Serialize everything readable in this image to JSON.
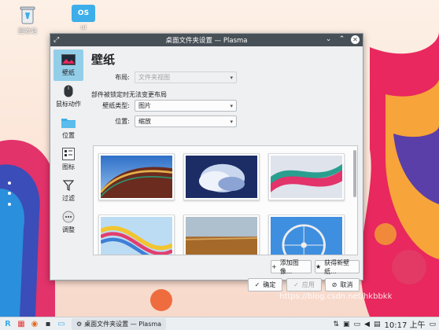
{
  "desktop": {
    "icons": [
      {
        "label": "回收站"
      },
      {
        "label": "OS",
        "caption": "ui"
      }
    ]
  },
  "dialog": {
    "title": "桌面文件夹设置 — Plasma",
    "sidebar": [
      {
        "label": "壁纸",
        "icon": "wallpaper-icon",
        "active": true
      },
      {
        "label": "鼠标动作",
        "icon": "mouse-icon",
        "active": false
      },
      {
        "label": "位置",
        "icon": "folder-icon",
        "active": false
      },
      {
        "label": "图标",
        "icon": "icons-icon",
        "active": false
      },
      {
        "label": "过滤",
        "icon": "filter-icon",
        "active": false
      },
      {
        "label": "调整",
        "icon": "tweaks-icon",
        "active": false
      }
    ],
    "page_title": "壁纸",
    "layout": {
      "label": "布局:",
      "value": "文件夹视图"
    },
    "lock_notice": "部件被锁定时无法变更布局",
    "wallpaper_type": {
      "label": "壁纸类型:",
      "value": "图片"
    },
    "positioning": {
      "label": "位置:",
      "value": "缩放"
    },
    "add_image": "添加图像...",
    "get_new": "获得新壁纸...",
    "ok": "确定",
    "apply": "应用",
    "cancel": "取消"
  },
  "taskbar": {
    "task_title": "桌面文件夹设置 — Plasma",
    "clock": "10:17 上午"
  },
  "watermark": "https://blog.csdn.net/hkbbkk"
}
